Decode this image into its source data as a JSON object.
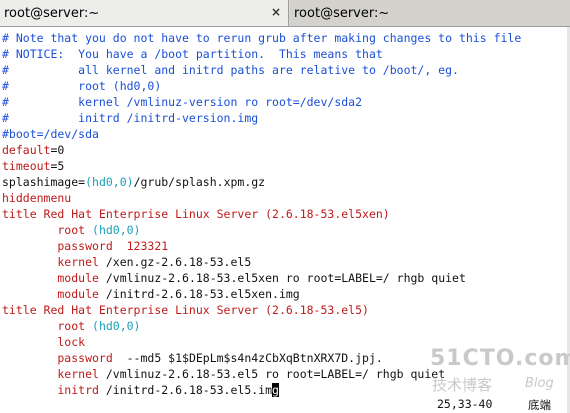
{
  "tabs": [
    {
      "label": "root@server:~",
      "close": "×"
    },
    {
      "label": "root@server:~"
    }
  ],
  "terminal_lines": [
    [
      {
        "t": "# Note that you do not have to rerun grub after making changes to this file",
        "c": "c-blue"
      }
    ],
    [
      {
        "t": "# NOTICE:  You have a /boot partition.  This means that",
        "c": "c-blue"
      }
    ],
    [
      {
        "t": "#          all kernel and initrd paths are relative to /boot/, eg.",
        "c": "c-blue"
      }
    ],
    [
      {
        "t": "#          root (hd0,0)",
        "c": "c-blue"
      }
    ],
    [
      {
        "t": "#          kernel /vmlinuz-version ro root=/dev/sda2",
        "c": "c-blue"
      }
    ],
    [
      {
        "t": "#          initrd /initrd-version.img",
        "c": "c-blue"
      }
    ],
    [
      {
        "t": "#boot=/dev/sda",
        "c": "c-blue"
      }
    ],
    [
      {
        "t": "default",
        "c": "c-red"
      },
      {
        "t": "=0",
        "c": "c-black"
      }
    ],
    [
      {
        "t": "timeout",
        "c": "c-red"
      },
      {
        "t": "=5",
        "c": "c-black"
      }
    ],
    [
      {
        "t": "splashimage=",
        "c": "c-black"
      },
      {
        "t": "(hd0,0)",
        "c": "c-cyan"
      },
      {
        "t": "/grub/splash.xpm.gz",
        "c": "c-black"
      }
    ],
    [
      {
        "t": "hiddenmenu",
        "c": "c-red"
      }
    ],
    [
      {
        "t": "title Red Hat Enterprise Linux Server (2.6.18-53.el5xen)",
        "c": "c-red"
      }
    ],
    [
      {
        "t": "        root ",
        "c": "c-red"
      },
      {
        "t": "(hd0,0)",
        "c": "c-cyan"
      }
    ],
    [
      {
        "t": "        password  123321",
        "c": "c-red"
      }
    ],
    [
      {
        "t": "        kernel ",
        "c": "c-red"
      },
      {
        "t": "/xen.gz-2.6.18-53.el5",
        "c": "c-black"
      }
    ],
    [
      {
        "t": "        module ",
        "c": "c-red"
      },
      {
        "t": "/vmlinuz-2.6.18-53.el5xen ro root=LABEL=/ rhgb quiet",
        "c": "c-black"
      }
    ],
    [
      {
        "t": "        module ",
        "c": "c-red"
      },
      {
        "t": "/initrd-2.6.18-53.el5xen.img",
        "c": "c-black"
      }
    ],
    [
      {
        "t": "title Red Hat Enterprise Linux Server (2.6.18-53.el5)",
        "c": "c-red"
      }
    ],
    [
      {
        "t": "        root ",
        "c": "c-red"
      },
      {
        "t": "(hd0,0)",
        "c": "c-cyan"
      }
    ],
    [
      {
        "t": "        lock",
        "c": "c-red"
      }
    ],
    [
      {
        "t": "        password ",
        "c": "c-red"
      },
      {
        "t": " --md5 $1$DEpLm$s4n4zCbXqBtnXRX7D.jpj.",
        "c": "c-black"
      }
    ],
    [
      {
        "t": "        kernel ",
        "c": "c-red"
      },
      {
        "t": "/vmlinuz-2.6.18-53.el5 ro root=LABEL=/ rhgb quiet",
        "c": "c-black"
      }
    ],
    [
      {
        "t": "        initrd ",
        "c": "c-red"
      },
      {
        "t": "/initrd-2.6.18-53.el5.im",
        "c": "c-black"
      },
      {
        "t": "g",
        "c": "cursor"
      }
    ]
  ],
  "status": {
    "position": "25,33-40",
    "mode": "底端"
  },
  "watermark": {
    "main": "51CTO.com",
    "sub": "技术博客",
    "blog": "Blog"
  }
}
